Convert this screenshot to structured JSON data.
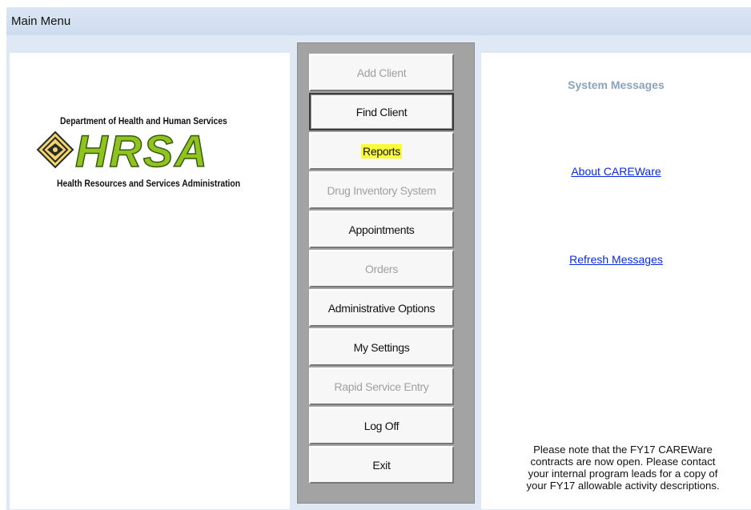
{
  "window": {
    "title": "Main Menu"
  },
  "logo": {
    "line1": "Department of Health and Human Services",
    "wordmark": "HRSA",
    "line2": "Health Resources and Services Administration"
  },
  "menu": {
    "buttons": [
      {
        "label": "Add Client",
        "enabled": false
      },
      {
        "label": "Find Client",
        "enabled": true,
        "focused": true
      },
      {
        "label": "Reports",
        "enabled": true,
        "highlighted": true
      },
      {
        "label": "Drug Inventory System",
        "enabled": false
      },
      {
        "label": "Appointments",
        "enabled": true
      },
      {
        "label": "Orders",
        "enabled": false
      },
      {
        "label": "Administrative Options",
        "enabled": true
      },
      {
        "label": "My Settings",
        "enabled": true
      },
      {
        "label": "Rapid Service Entry",
        "enabled": false
      },
      {
        "label": "Log Off",
        "enabled": true
      },
      {
        "label": "Exit",
        "enabled": true
      }
    ]
  },
  "messages": {
    "title": "System Messages",
    "about_link": "About CAREWare",
    "refresh_link": "Refresh Messages",
    "notice_lines": [
      "Please note that the FY17 CAREWare",
      "contracts are now open.  Please contact",
      "your internal program leads for a copy of",
      "your FY17 allowable activity descriptions."
    ]
  },
  "colors": {
    "titlebar": "#dbe6f4",
    "highlight": "#fafc3a",
    "link": "#0a2adf",
    "disabled_text": "#a0a0a0",
    "messages_title": "#8aa2bd",
    "logo_green": "#8fc320"
  }
}
